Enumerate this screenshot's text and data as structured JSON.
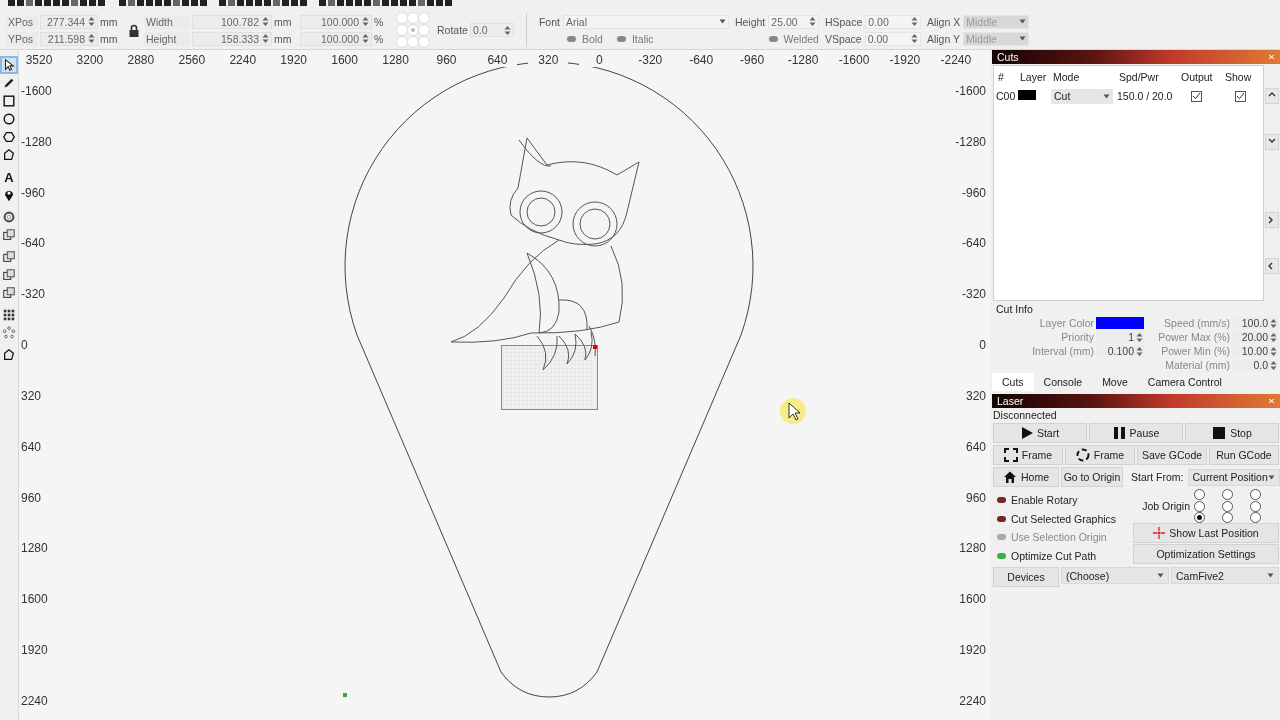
{
  "transform": {
    "rows": [
      [
        {
          "label": "XPos",
          "value": "277.344",
          "unit": "mm"
        },
        {
          "label": "Width",
          "value": "100.782",
          "unit": "mm"
        },
        {
          "value": "100.000",
          "unit": "%"
        }
      ],
      [
        {
          "label": "YPos",
          "value": "211.598",
          "unit": "mm"
        },
        {
          "label": "Height",
          "value": "158.333",
          "unit": "mm"
        },
        {
          "value": "100.000",
          "unit": "%"
        }
      ]
    ],
    "locked": true,
    "anchor": [
      {
        "selected": false
      },
      {
        "selected": false
      },
      {
        "selected": false
      },
      {
        "selected": false
      },
      {
        "selected": true
      },
      {
        "selected": false
      },
      {
        "selected": false
      },
      {
        "selected": false
      },
      {
        "selected": false
      }
    ],
    "rotate": {
      "label": "Rotate",
      "value": "0.0"
    }
  },
  "text_options": {
    "font": {
      "label": "Font",
      "value": "Arial"
    },
    "height": {
      "label": "Height",
      "value": "25.00"
    },
    "hspace": {
      "label": "HSpace",
      "value": "0.00"
    },
    "vspace": {
      "label": "VSpace",
      "value": "0.00"
    },
    "align_x": {
      "label": "Align X",
      "value": "Middle",
      "disabled": true
    },
    "align_y": {
      "label": "Align Y",
      "value": "Middle",
      "disabled": true
    },
    "toggles": [
      {
        "label": "Bold",
        "on": false
      },
      {
        "label": "Italic",
        "on": false
      },
      {
        "label": "Welded",
        "on": false
      }
    ]
  },
  "tool_groups": [
    [
      {
        "kind": "select",
        "selected": true
      },
      {
        "kind": "pencil",
        "selected": false
      },
      {
        "kind": "rectangle",
        "selected": false
      },
      {
        "kind": "ellipse",
        "selected": false
      },
      {
        "kind": "hexagon",
        "selected": false
      },
      {
        "kind": "pentagon",
        "selected": false
      }
    ],
    [
      {
        "kind": "text",
        "glyph": "A",
        "selected": false
      },
      {
        "kind": "pin",
        "selected": false
      }
    ],
    [
      {
        "kind": "ring",
        "selected": false
      },
      {
        "kind": "squares",
        "selected": false
      }
    ],
    [
      {
        "kind": "squares",
        "selected": false
      },
      {
        "kind": "squares",
        "selected": false
      },
      {
        "kind": "squares",
        "selected": false
      }
    ],
    [
      {
        "kind": "grid",
        "selected": false
      },
      {
        "kind": "dots_circle",
        "selected": false
      }
    ],
    [
      {
        "kind": "pentagon",
        "selected": false
      }
    ]
  ],
  "canvas": {
    "top_ruler": [
      "3520",
      "3200",
      "2880",
      "2560",
      "2240",
      "1920",
      "1600",
      "1280",
      "960",
      "640",
      "320",
      "0",
      "-320",
      "-640",
      "-960",
      "-1280",
      "-1600",
      "-1920",
      "-2240"
    ],
    "left_ruler": [
      "-1600",
      "-1280",
      "-960",
      "-640",
      "-320",
      "0",
      "320",
      "640",
      "960",
      "1280",
      "1600",
      "1920",
      "2240"
    ],
    "right_ruler": [
      "-1600",
      "-1280",
      "-960",
      "-640",
      "-320",
      "0",
      "320",
      "640",
      "960",
      "1280",
      "1600",
      "1920",
      "2240"
    ]
  },
  "cuts_window": {
    "title": "Cuts",
    "columns": [
      "#",
      "Layer",
      "Mode",
      "Spd/Pwr",
      "Output",
      "Show"
    ],
    "rows": [
      {
        "number": "C00",
        "color": "#000000",
        "mode": "Cut",
        "speed_power": "150.0 / 20.0",
        "output": true,
        "show": true
      }
    ]
  },
  "cut_info": {
    "title": "Cut Info",
    "layer_color": {
      "label": "Layer Color",
      "color": "#0000ff"
    },
    "left_fields": [
      {
        "label": "Priority",
        "value": "1"
      },
      {
        "label": "Interval (mm)",
        "value": "0.100"
      }
    ],
    "right_fields": [
      {
        "label": "Speed (mm/s)",
        "value": "100.0"
      },
      {
        "label": "Power Max (%)",
        "value": "20.00"
      },
      {
        "label": "Power Min (%)",
        "value": "10.00"
      },
      {
        "label": "Material (mm)",
        "value": "0.0"
      }
    ]
  },
  "dock_tabs": [
    {
      "label": "Cuts",
      "selected": true
    },
    {
      "label": "Console",
      "selected": false
    },
    {
      "label": "Move",
      "selected": false
    },
    {
      "label": "Camera Control",
      "selected": false
    }
  ],
  "laser": {
    "title": "Laser",
    "status": "Disconnected",
    "button_rows": [
      [
        {
          "kind": "start",
          "label": "Start"
        },
        {
          "kind": "pause",
          "label": "Pause"
        },
        {
          "kind": "stop",
          "label": "Stop"
        }
      ],
      [
        {
          "kind": "frame_rect",
          "label": "Frame"
        },
        {
          "kind": "frame_circle",
          "label": "Frame"
        },
        {
          "kind": "plain",
          "label": "Save GCode"
        },
        {
          "kind": "plain",
          "label": "Run GCode"
        }
      ],
      [
        {
          "kind": "home",
          "label": "Home"
        },
        {
          "kind": "plain",
          "label": "Go to Origin"
        }
      ]
    ],
    "start_from": {
      "label": "Start From:",
      "value": "Current Position"
    },
    "options": [
      {
        "label": "Enable Rotary",
        "on": false,
        "disabled": false
      },
      {
        "label": "Cut Selected Graphics",
        "on": false,
        "disabled": false
      },
      {
        "label": "Use Selection Origin",
        "on": false,
        "disabled": true
      },
      {
        "label": "Optimize Cut Path",
        "on": true,
        "disabled": false
      }
    ],
    "job_origin": {
      "label": "Job Origin",
      "points": [
        {
          "selected": false
        },
        {
          "selected": false
        },
        {
          "selected": false
        },
        {
          "selected": false
        },
        {
          "selected": false
        },
        {
          "selected": false
        },
        {
          "selected": true
        },
        {
          "selected": false
        },
        {
          "selected": false
        }
      ]
    },
    "side_buttons": [
      {
        "kind": "crosshair",
        "label": "Show Last Position"
      },
      {
        "kind": "plain",
        "label": "Optimization Settings"
      }
    ],
    "devices": {
      "label": "Devices",
      "port": "(Choose)",
      "device": "CamFive2"
    }
  }
}
